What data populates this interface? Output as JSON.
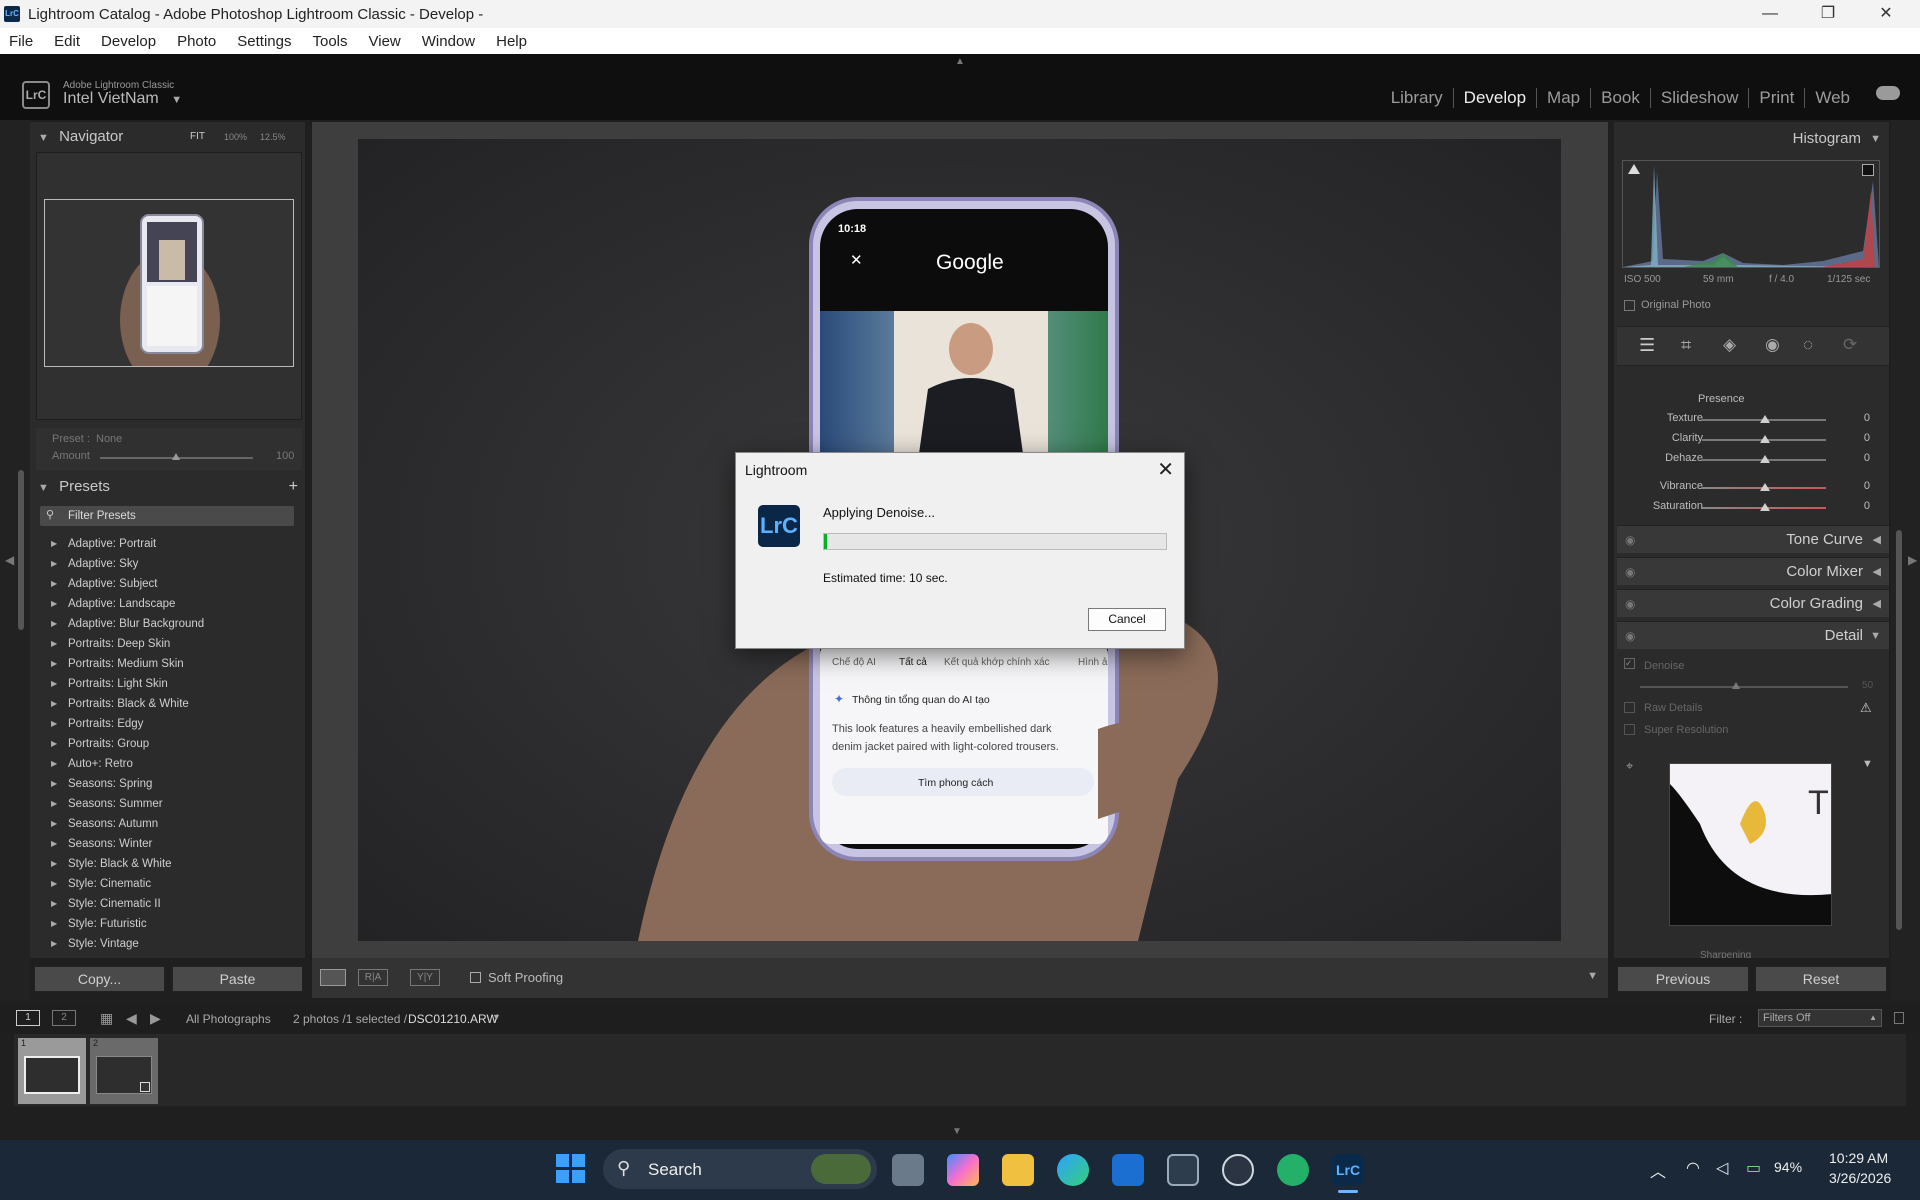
{
  "window": {
    "title": "Lightroom Catalog - Adobe Photoshop Lightroom Classic - Develop -"
  },
  "menu": [
    "File",
    "Edit",
    "Develop",
    "Photo",
    "Settings",
    "Tools",
    "View",
    "Window",
    "Help"
  ],
  "header": {
    "brand_small": "Adobe Lightroom Classic",
    "user": "Intel VietNam",
    "app_logo": "LrC"
  },
  "modules": [
    "Library",
    "Develop",
    "Map",
    "Book",
    "Slideshow",
    "Print",
    "Web"
  ],
  "navigator": {
    "title": "Navigator",
    "zoom_fit": "FIT",
    "zoom_100": "100%",
    "zoom_125": "12.5%"
  },
  "preset_amount": {
    "preset_label": "Preset :",
    "preset_value": "None",
    "amount_label": "Amount",
    "amount_value": "100"
  },
  "presets": {
    "title": "Presets",
    "filter_placeholder": "Filter Presets",
    "items": [
      "Adaptive: Portrait",
      "Adaptive: Sky",
      "Adaptive: Subject",
      "Adaptive: Landscape",
      "Adaptive: Blur Background",
      "Portraits: Deep Skin",
      "Portraits: Medium Skin",
      "Portraits: Light Skin",
      "Portraits: Black & White",
      "Portraits: Edgy",
      "Portraits: Group",
      "Auto+: Retro",
      "Seasons: Spring",
      "Seasons: Summer",
      "Seasons: Autumn",
      "Seasons: Winter",
      "Style: Black & White",
      "Style: Cinematic",
      "Style: Cinematic II",
      "Style: Futuristic",
      "Style: Vintage"
    ]
  },
  "left_buttons": {
    "copy": "Copy...",
    "paste": "Paste"
  },
  "toolbar": {
    "soft_proofing": "Soft Proofing"
  },
  "histogram": {
    "title": "Histogram",
    "iso": "ISO 500",
    "focal": "59 mm",
    "aperture": "f / 4.0",
    "shutter": "1/125 sec",
    "original_photo": "Original Photo"
  },
  "presence": {
    "title": "Presence",
    "sliders": [
      {
        "label": "Texture",
        "value": "0"
      },
      {
        "label": "Clarity",
        "value": "0"
      },
      {
        "label": "Dehaze",
        "value": "0"
      },
      {
        "label": "Vibrance",
        "value": "0"
      },
      {
        "label": "Saturation",
        "value": "0"
      }
    ]
  },
  "sections": [
    "Tone Curve",
    "Color Mixer",
    "Color Grading",
    "Detail"
  ],
  "detail": {
    "denoise": "Denoise",
    "denoise_value": "50",
    "raw_details": "Raw Details",
    "super_resolution": "Super Resolution",
    "sharpening": "Sharpening"
  },
  "right_buttons": {
    "previous": "Previous",
    "reset": "Reset"
  },
  "filmbar": {
    "view1": "1",
    "view2": "2",
    "source": "All Photographs",
    "count": "2 photos /1 selected /",
    "filename": "DSC01210.ARW",
    "filter_label": "Filter :",
    "filter_value": "Filters Off"
  },
  "filmstrip": {
    "thumb1_index": "1",
    "thumb2_index": "2"
  },
  "phone_screen": {
    "time": "10:18",
    "app": "Google",
    "tabs": [
      "Chế độ AI",
      "Tất cả",
      "Kết quả khớp chính xác",
      "Hình ả"
    ],
    "ai_overview": "Thông tin tổng quan do AI tạo",
    "description": "This look features a heavily embellished dark denim jacket paired with light-colored trousers.",
    "style_button": "Tìm phong cách"
  },
  "dialog": {
    "title": "Lightroom",
    "message": "Applying Denoise...",
    "progress": 0.005,
    "eta": "Estimated time: 10 sec.",
    "cancel": "Cancel",
    "icon": "LrC"
  },
  "taskbar": {
    "search": "Search",
    "battery": "94%",
    "time": "10:29 AM",
    "date": "3/26/2026"
  },
  "colors": {
    "accent_progress": "#06b025",
    "lr_blue": "#0a2748",
    "taskbar": "#1b2838"
  }
}
